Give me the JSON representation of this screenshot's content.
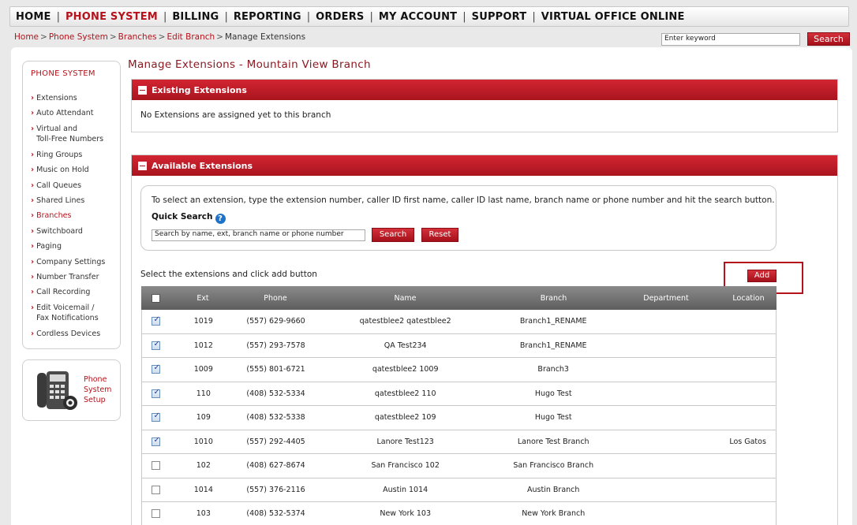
{
  "nav": {
    "items": [
      {
        "label": "HOME",
        "active": false
      },
      {
        "label": "PHONE SYSTEM",
        "active": true
      },
      {
        "label": "BILLING",
        "active": false
      },
      {
        "label": "REPORTING",
        "active": false
      },
      {
        "label": "ORDERS",
        "active": false
      },
      {
        "label": "MY ACCOUNT",
        "active": false
      },
      {
        "label": "SUPPORT",
        "active": false
      },
      {
        "label": "VIRTUAL OFFICE ONLINE",
        "active": false
      }
    ],
    "separator": "|"
  },
  "breadcrumb": {
    "items": [
      "Home",
      "Phone System",
      "Branches",
      "Edit Branch"
    ],
    "current": "Manage Extensions",
    "sep": ">"
  },
  "top_search": {
    "value": "Enter keyword",
    "button": "Search"
  },
  "sidebar": {
    "title": "PHONE SYSTEM",
    "items": [
      {
        "label": "Extensions"
      },
      {
        "label": "Auto Attendant"
      },
      {
        "label": "Virtual and",
        "label2": "Toll-Free Numbers"
      },
      {
        "label": "Ring Groups"
      },
      {
        "label": "Music on Hold"
      },
      {
        "label": "Call Queues"
      },
      {
        "label": "Shared Lines"
      },
      {
        "label": "Branches",
        "active": true
      },
      {
        "label": "Switchboard"
      },
      {
        "label": "Paging"
      },
      {
        "label": "Company Settings"
      },
      {
        "label": "Number Transfer"
      },
      {
        "label": "Call Recording"
      },
      {
        "label": "Edit Voicemail /",
        "label2": "Fax Notifications"
      },
      {
        "label": "Cordless Devices"
      }
    ]
  },
  "setup": {
    "line1": "Phone",
    "line2": "System",
    "line3": "Setup",
    "icon": "phone-setup-icon"
  },
  "page_title": "Manage Extensions - Mountain View Branch",
  "existing": {
    "header": "Existing Extensions",
    "message": "No Extensions are assigned yet to this branch"
  },
  "available": {
    "header": "Available Extensions",
    "instructions": "To select an extension, type the extension number, caller ID first name, caller ID last name, branch name or phone number and hit the search button.",
    "quick_search_label": "Quick Search",
    "search_value": "Search by name, ext, branch name or phone number",
    "search_button": "Search",
    "reset_button": "Reset",
    "select_text": "Select the extensions and click add button",
    "add_button": "Add"
  },
  "table": {
    "headers": {
      "ext": "Ext",
      "phone": "Phone",
      "name": "Name",
      "branch": "Branch",
      "department": "Department",
      "location": "Location"
    },
    "rows": [
      {
        "checked": true,
        "ext": "1019",
        "phone": "(557) 629-9660",
        "name": "qatestblee2 qatestblee2",
        "branch": "Branch1_RENAME",
        "department": "",
        "location": ""
      },
      {
        "checked": true,
        "ext": "1012",
        "phone": "(557) 293-7578",
        "name": "QA Test234",
        "branch": "Branch1_RENAME",
        "department": "",
        "location": ""
      },
      {
        "checked": true,
        "ext": "1009",
        "phone": "(555) 801-6721",
        "name": "qatestblee2 1009",
        "branch": "Branch3",
        "department": "",
        "location": ""
      },
      {
        "checked": true,
        "ext": "110",
        "phone": "(408) 532-5334",
        "name": "qatestblee2 110",
        "branch": "Hugo Test",
        "department": "",
        "location": ""
      },
      {
        "checked": true,
        "ext": "109",
        "phone": "(408) 532-5338",
        "name": "qatestblee2 109",
        "branch": "Hugo Test",
        "department": "",
        "location": ""
      },
      {
        "checked": true,
        "ext": "1010",
        "phone": "(557) 292-4405",
        "name": "Lanore Test123",
        "branch": "Lanore Test Branch",
        "department": "",
        "location": "Los Gatos"
      },
      {
        "checked": false,
        "ext": "102",
        "phone": "(408) 627-8674",
        "name": "San Francisco 102",
        "branch": "San Francisco Branch",
        "department": "",
        "location": ""
      },
      {
        "checked": false,
        "ext": "1014",
        "phone": "(557) 376-2116",
        "name": "Austin 1014",
        "branch": "Austin Branch",
        "department": "",
        "location": ""
      },
      {
        "checked": false,
        "ext": "103",
        "phone": "(408) 532-5374",
        "name": "New York 103",
        "branch": "New York Branch",
        "department": "",
        "location": ""
      }
    ]
  },
  "colors": {
    "accent": "#b5121b",
    "header_red": "#c41e2a",
    "table_header": "#6e6e6e"
  }
}
